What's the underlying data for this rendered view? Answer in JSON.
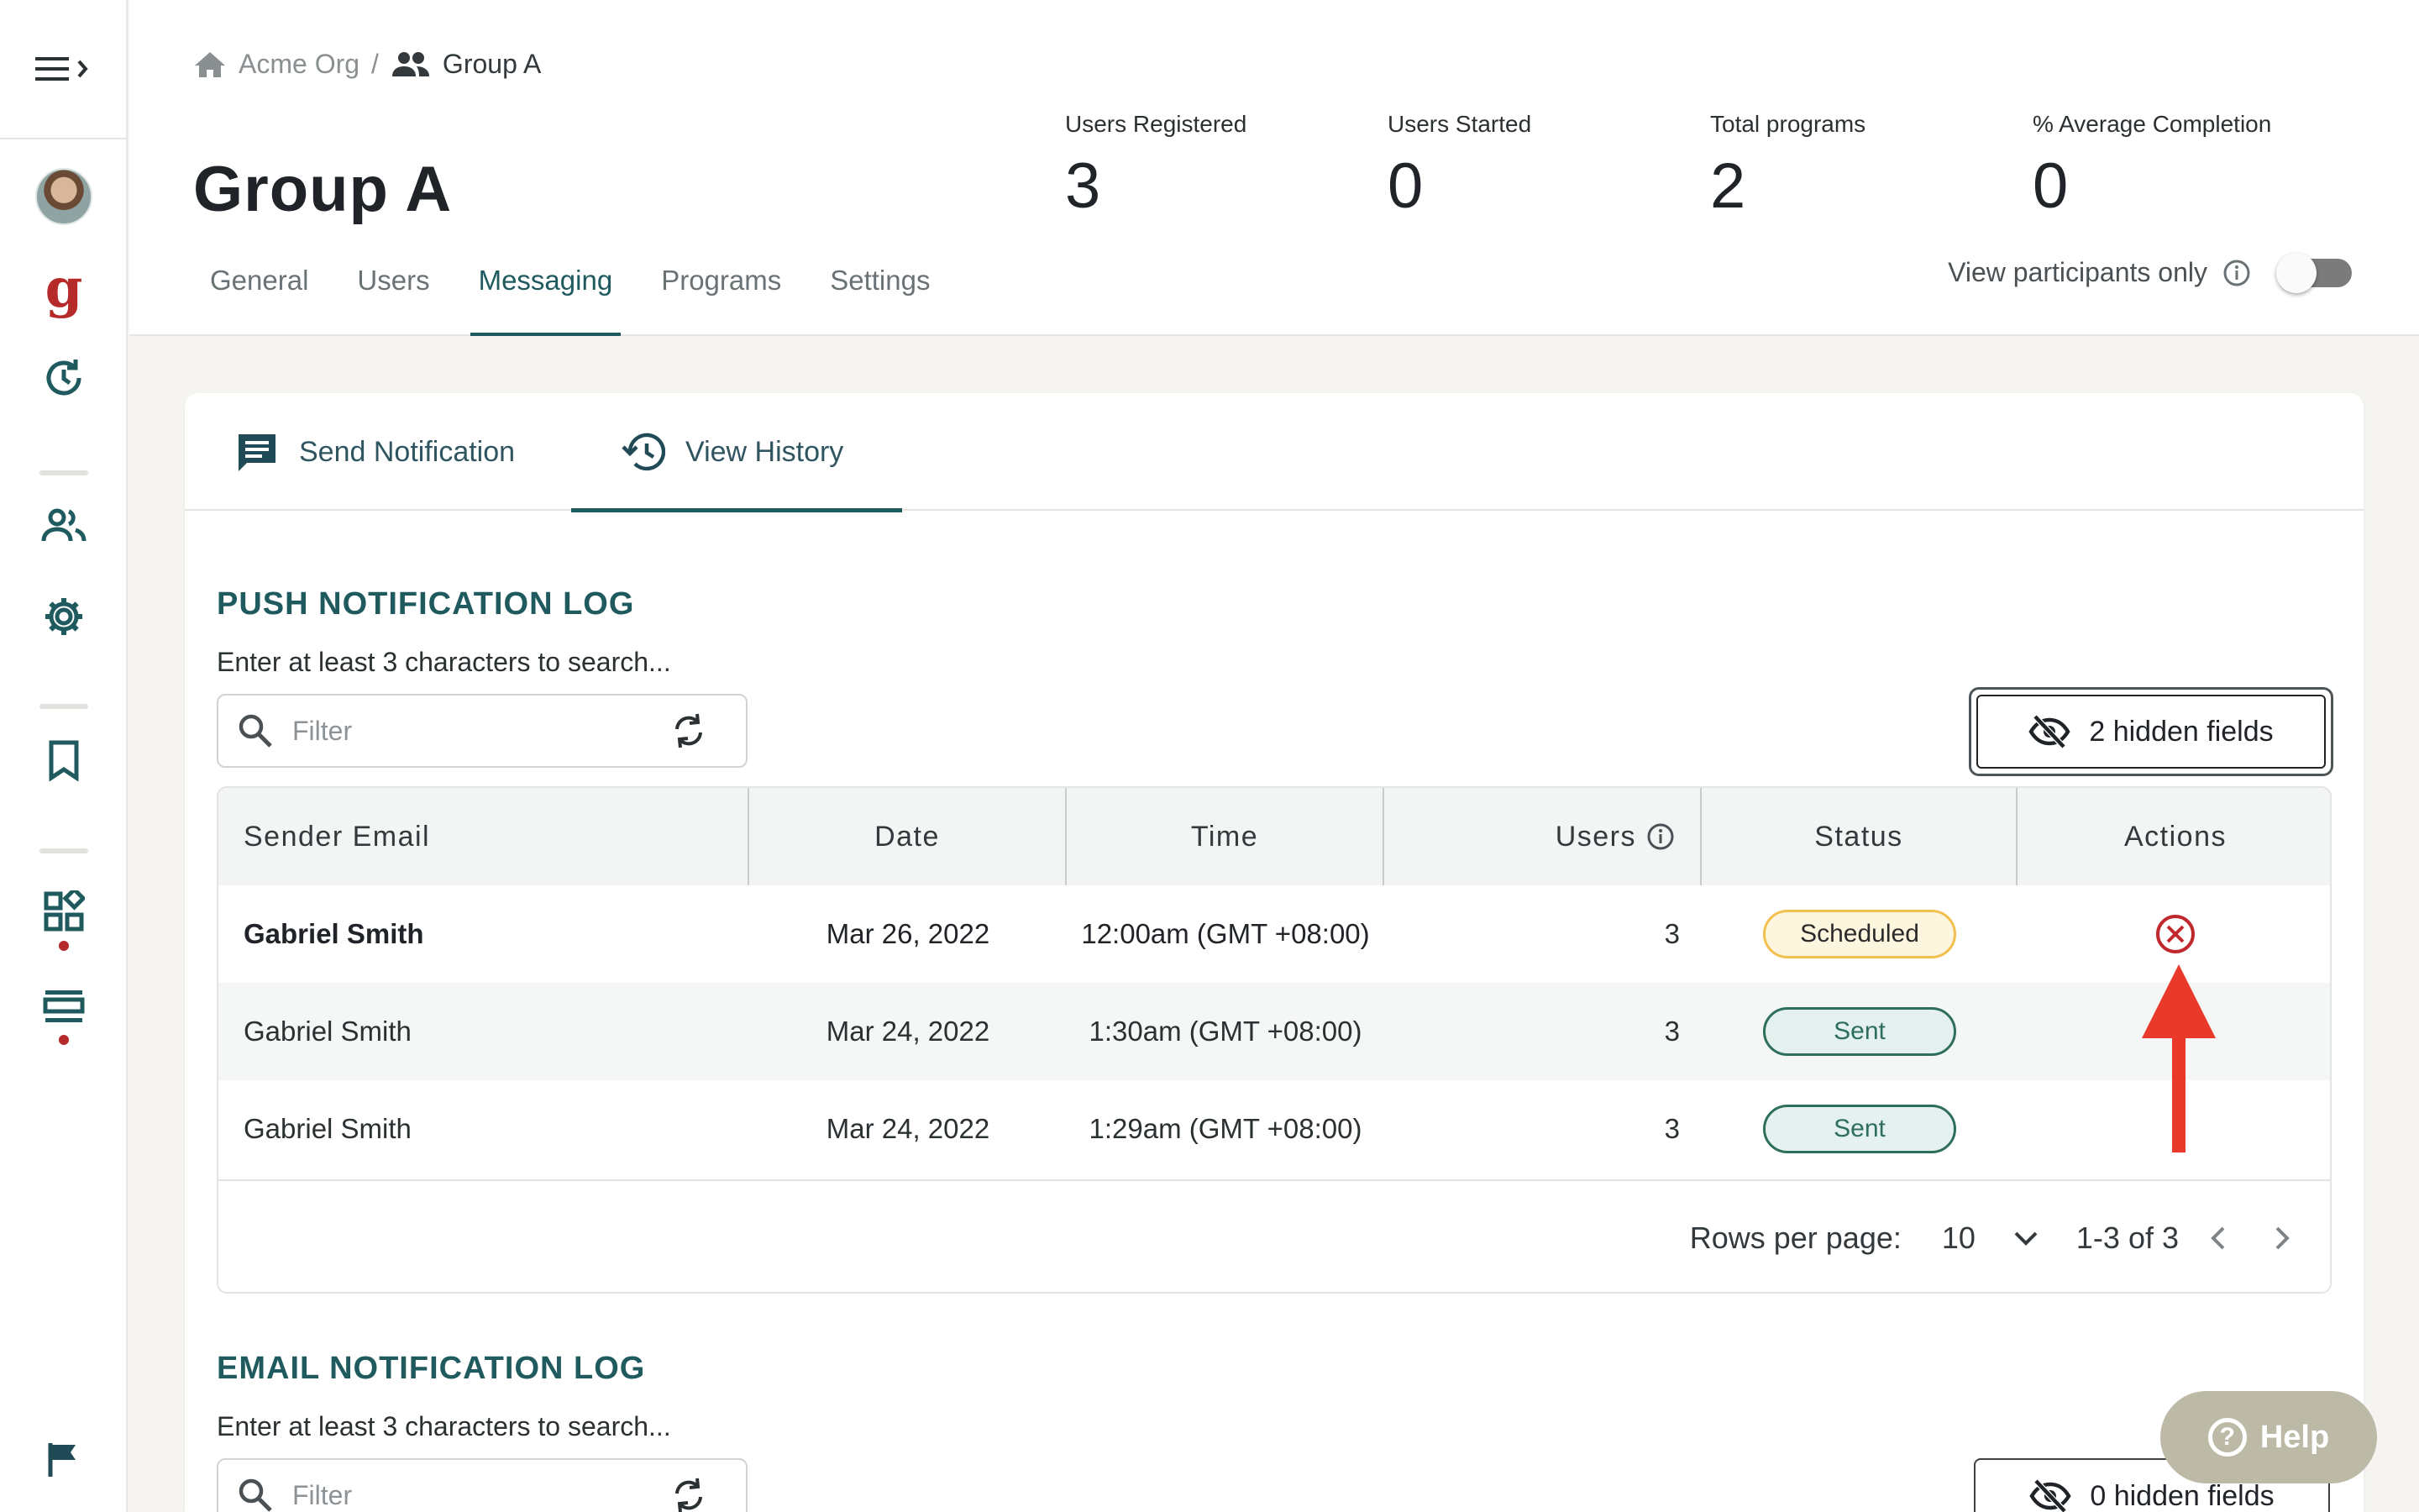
{
  "breadcrumb": {
    "org": "Acme Org",
    "separator": "/",
    "group": "Group A"
  },
  "page": {
    "title": "Group A"
  },
  "stats": [
    {
      "label": "Users Registered",
      "value": "3"
    },
    {
      "label": "Users Started",
      "value": "0"
    },
    {
      "label": "Total programs",
      "value": "2"
    },
    {
      "label": "% Average Completion",
      "value": "0"
    }
  ],
  "tabs": [
    {
      "label": "General",
      "active": false
    },
    {
      "label": "Users",
      "active": false
    },
    {
      "label": "Messaging",
      "active": true
    },
    {
      "label": "Programs",
      "active": false
    },
    {
      "label": "Settings",
      "active": false
    }
  ],
  "participants_toggle": {
    "label": "View participants only",
    "checked": false
  },
  "messaging_tabs": [
    {
      "label": "Send Notification",
      "icon": "message-icon",
      "active": false
    },
    {
      "label": "View History",
      "icon": "history-icon",
      "active": true
    }
  ],
  "push_log": {
    "title": "PUSH NOTIFICATION LOG",
    "search_hint": "Enter at least 3 characters to search...",
    "filter_placeholder": "Filter",
    "hidden_fields_label": "2 hidden fields",
    "columns": [
      "Sender Email",
      "Date",
      "Time",
      "Users",
      "Status",
      "Actions"
    ],
    "rows": [
      {
        "sender": "Gabriel Smith",
        "date": "Mar 26, 2022",
        "time": "12:00am (GMT +08:00)",
        "users": "3",
        "status": "Scheduled",
        "has_cancel": true
      },
      {
        "sender": "Gabriel Smith",
        "date": "Mar 24, 2022",
        "time": "1:30am (GMT +08:00)",
        "users": "3",
        "status": "Sent",
        "has_cancel": false
      },
      {
        "sender": "Gabriel Smith",
        "date": "Mar 24, 2022",
        "time": "1:29am (GMT +08:00)",
        "users": "3",
        "status": "Sent",
        "has_cancel": false
      }
    ],
    "pagination": {
      "rows_per_page_label": "Rows per page:",
      "rows_per_page": "10",
      "range": "1-3 of 3"
    }
  },
  "email_log": {
    "title": "EMAIL NOTIFICATION LOG",
    "search_hint": "Enter at least 3 characters to search...",
    "filter_placeholder": "Filter",
    "hidden_fields_label": "0 hidden fields"
  },
  "help": {
    "label": "Help"
  },
  "colors": {
    "accent": "#1f5a5f",
    "brand_red": "#b72a2a",
    "scheduled_border": "#f2c04d",
    "sent_border": "#2e6e5c",
    "annotation_arrow": "#e8392a"
  }
}
